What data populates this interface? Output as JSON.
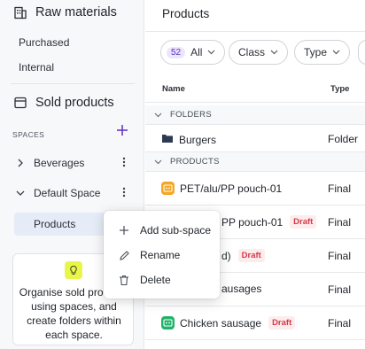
{
  "sidebar": {
    "raw_materials": {
      "title": "Raw materials",
      "icon": "building-icon"
    },
    "raw_links": [
      "Purchased",
      "Internal"
    ],
    "sold_products": {
      "title": "Sold products",
      "icon": "window-icon"
    },
    "spaces_label": "SPACES",
    "add_space_icon": "plus-icon",
    "tree": [
      {
        "label": "Beverages",
        "expanded": false
      },
      {
        "label": "Default Space",
        "expanded": true
      },
      {
        "label": "Products",
        "selected": true
      }
    ],
    "tip": {
      "icon": "lightbulb-icon",
      "text": "Organise sold products using spaces, and create folders within each space."
    }
  },
  "main": {
    "title": "Products",
    "filters": [
      {
        "count": "52",
        "label": "All"
      },
      {
        "label": "Class"
      },
      {
        "label": "Type"
      }
    ],
    "columns": [
      "Name",
      "Type"
    ],
    "groups": [
      {
        "label": "FOLDERS",
        "rows": [
          {
            "name": "Burgers",
            "type": "Folder",
            "icon": "folder-icon"
          }
        ]
      },
      {
        "label": "PRODUCTS",
        "rows": [
          {
            "name": "PET/alu/PP pouch-01",
            "type": "Final",
            "icon": "product-icon-orange",
            "draft": ""
          },
          {
            "name": "PP pouch-01",
            "type": "Final",
            "icon": "",
            "draft": "Draft"
          },
          {
            "name": "d)",
            "type": "Final",
            "icon": "",
            "draft": "Draft"
          },
          {
            "name": "ausages",
            "type": "Final",
            "icon": "",
            "draft": ""
          },
          {
            "name": "Chicken sausage",
            "type": "Final",
            "icon": "product-icon-green",
            "draft": "Draft"
          }
        ]
      }
    ]
  },
  "context_menu": {
    "items": [
      {
        "label": "Add sub-space",
        "icon": "plus-icon"
      },
      {
        "label": "Rename",
        "icon": "pencil-icon"
      },
      {
        "label": "Delete",
        "icon": "trash-icon"
      }
    ]
  },
  "colors": {
    "accent": "#6b38c4",
    "draft_bg": "#fdecec",
    "draft_text": "#d6384a",
    "selected_bg": "#e5ecf7",
    "tip_bulb": "#e8f64a",
    "icon_orange": "#f5a623",
    "icon_green": "#21b36a"
  }
}
